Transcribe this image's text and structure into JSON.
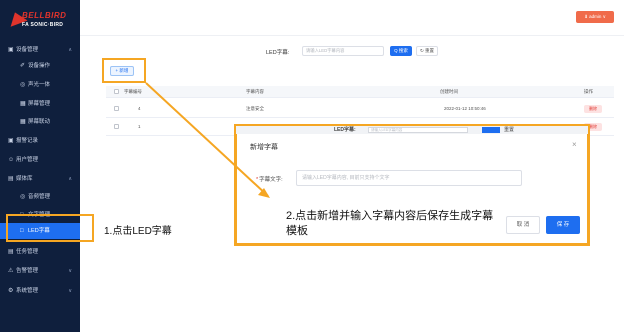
{
  "brand": {
    "name": "BELLBIRD",
    "sub": "FA SONIC·BIRD"
  },
  "header": {
    "user_label": "⬇ admin ∨"
  },
  "sidebar": {
    "items": [
      {
        "icon": "▣",
        "label": "设备管理",
        "caret": "∧"
      },
      {
        "icon": "✐",
        "label": "设备操作"
      },
      {
        "icon": "◎",
        "label": "声光一体"
      },
      {
        "icon": "▦",
        "label": "屏幕管理"
      },
      {
        "icon": "▦",
        "label": "屏幕联动"
      },
      {
        "icon": "▣",
        "label": "报警记录"
      },
      {
        "icon": "☺",
        "label": "用户管理"
      },
      {
        "icon": "▤",
        "label": "媒体库",
        "caret": "∧"
      },
      {
        "icon": "◎",
        "label": "音频管理"
      },
      {
        "icon": "□",
        "label": "文字管理"
      },
      {
        "icon": "□",
        "label": "LED字幕"
      },
      {
        "icon": "▤",
        "label": "任务管理"
      },
      {
        "icon": "⚠",
        "label": "告警管理",
        "caret": "∨"
      },
      {
        "icon": "⚙",
        "label": "系统管理",
        "caret": "∨"
      }
    ]
  },
  "search": {
    "label": "LED字幕:",
    "placeholder": "请输入LED字幕内容",
    "search_button": "Q 搜索",
    "reset_button": "↻ 重置"
  },
  "toolbar": {
    "add_button": "+ 新增"
  },
  "table": {
    "headers": [
      "字幕编号",
      "字幕内容",
      "创建时间",
      "操作"
    ],
    "rows": [
      {
        "id": "4",
        "content": "注意安全",
        "time": "2022-01-12 10:50:46",
        "action": "删除"
      },
      {
        "id": "1",
        "content": "",
        "time": "",
        "action": "删除"
      }
    ]
  },
  "ghost_bar": {
    "label": "LED字幕:",
    "placeholder": "请输入LED字幕内容",
    "reset": "重置"
  },
  "dialog": {
    "title": "新增字幕",
    "close": "×",
    "field_required": "*",
    "field_label": "字幕文字:",
    "field_placeholder": "请输入LED字幕内容, 目前只支持个文字",
    "cancel_button": "取 消",
    "save_button": "保 存"
  },
  "annotations": {
    "step1": "1.点击LED字幕",
    "step2": "2.点击新增并输入字幕内容后保存生成字幕模板"
  },
  "colors": {
    "sidebar_bg": "#0f1f3d",
    "accent": "#1e6ef0",
    "brand_red": "#e0342c",
    "highlight_orange": "#f5a623",
    "user_button": "#f06b4a"
  }
}
